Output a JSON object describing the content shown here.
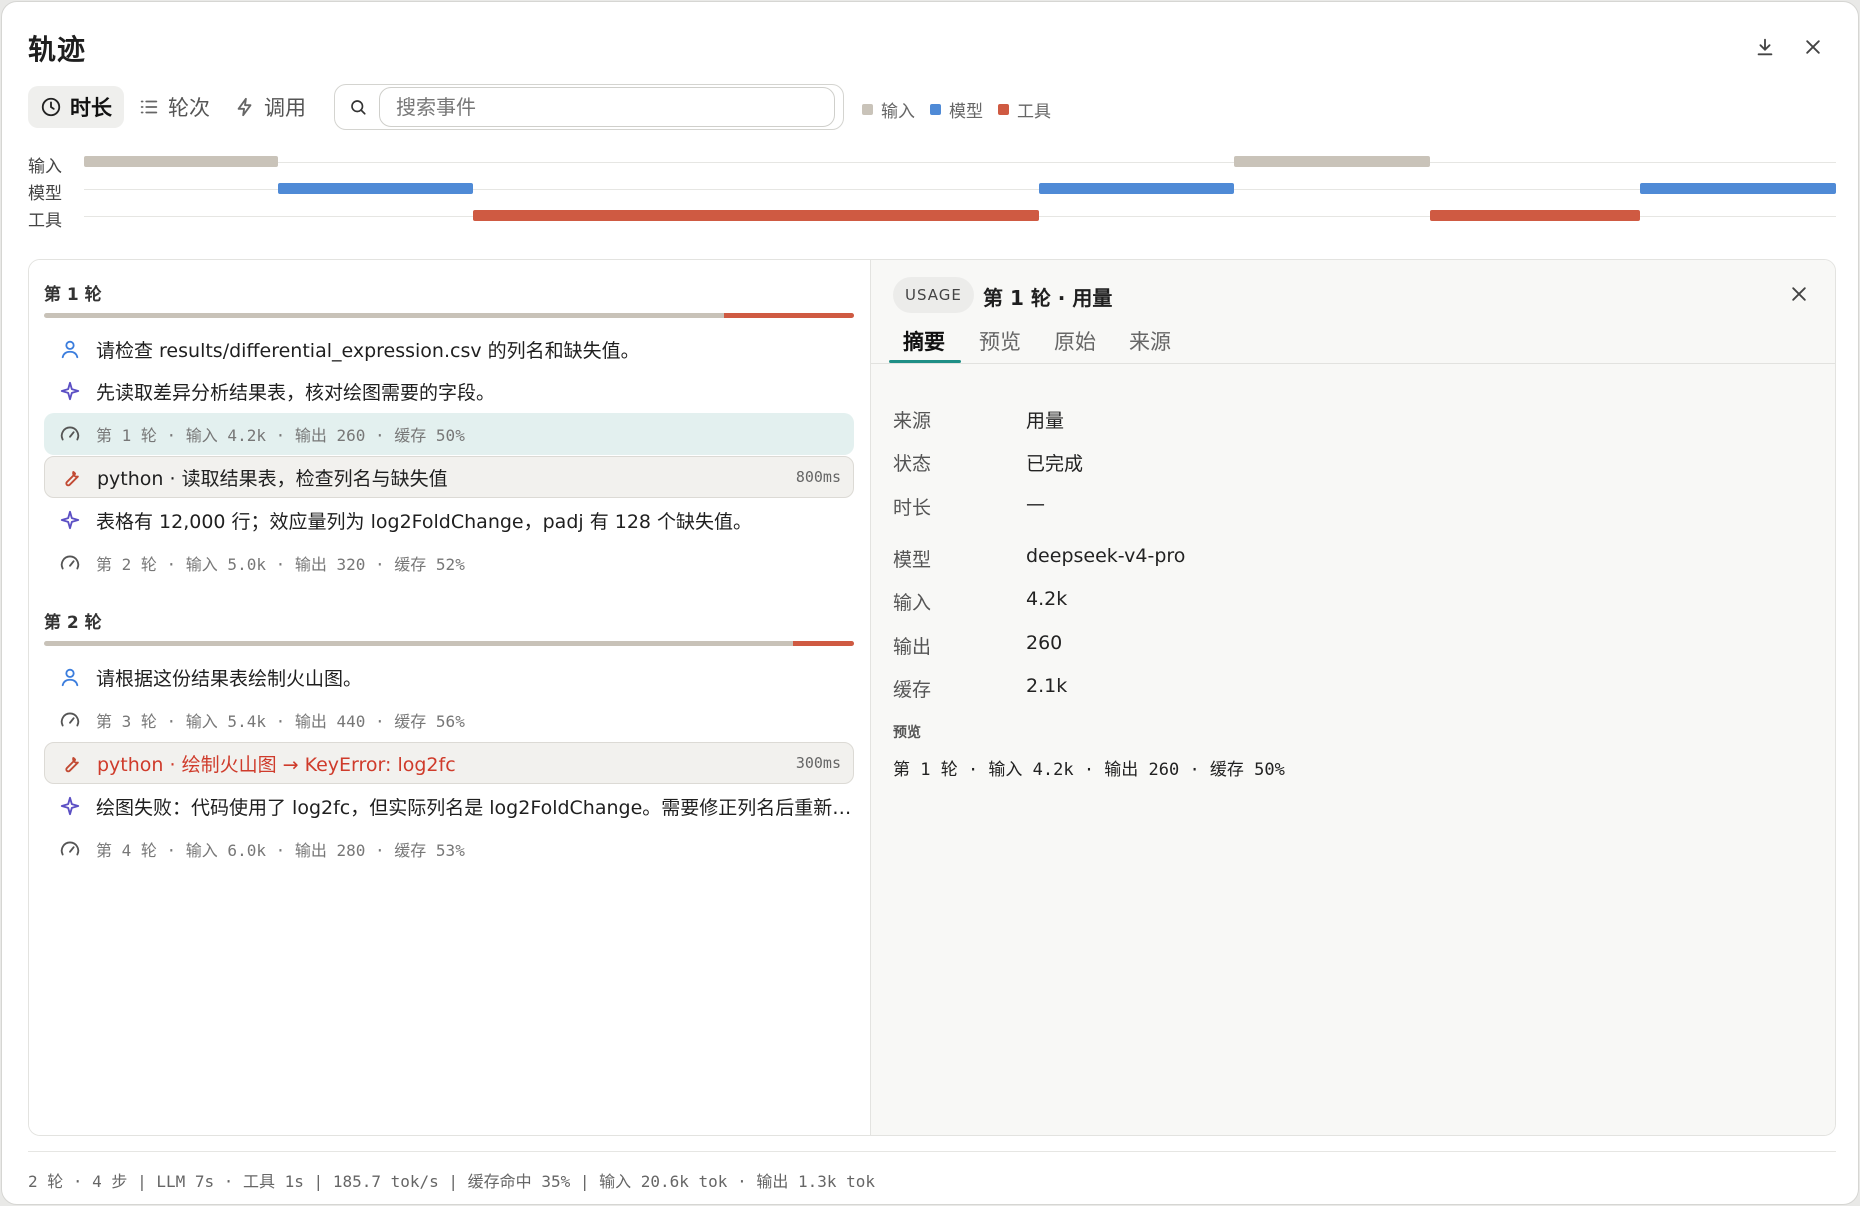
{
  "window": {
    "title": "轨迹"
  },
  "toolbar": {
    "segments": [
      {
        "label": "时长"
      },
      {
        "label": "轮次"
      },
      {
        "label": "调用"
      }
    ],
    "search_placeholder": "搜索事件",
    "legend": [
      {
        "label": "输入",
        "color": "#c9c3b9"
      },
      {
        "label": "模型",
        "color": "#4f8ad6"
      },
      {
        "label": "工具",
        "color": "#cf5a42"
      }
    ]
  },
  "timeline": {
    "lanes": [
      "输入",
      "模型",
      "工具"
    ]
  },
  "rounds": [
    {
      "title": "第 1 轮",
      "tool_share": 0.16,
      "items": [
        {
          "type": "user",
          "text": "请检查 results/differential_expression.csv 的列名和缺失值。"
        },
        {
          "type": "model",
          "text": "先读取差异分析结果表，核对绘图需要的字段。"
        },
        {
          "type": "usage",
          "text": "第 1 轮 · 输入 4.2k · 输出 260 · 缓存 50%",
          "selected": true
        },
        {
          "type": "tool",
          "text": "python · 读取结果表，检查列名与缺失值",
          "duration": "800ms"
        },
        {
          "type": "model",
          "text": "表格有 12,000 行；效应量列为 log2FoldChange，padj 有 128 个缺失值。"
        },
        {
          "type": "usage",
          "text": "第 2 轮 · 输入 5.0k · 输出 320 · 缓存 52%"
        }
      ]
    },
    {
      "title": "第 2 轮",
      "tool_share": 0.075,
      "items": [
        {
          "type": "user",
          "text": "请根据这份结果表绘制火山图。"
        },
        {
          "type": "usage",
          "text": "第 3 轮 · 输入 5.4k · 输出 440 · 缓存 56%"
        },
        {
          "type": "tool",
          "text": "python · 绘制火山图 → KeyError: log2fc",
          "duration": "300ms",
          "error": true
        },
        {
          "type": "model",
          "text": "绘图失败：代码使用了 log2fc，但实际列名是 log2FoldChange。需要修正列名后重新绘图。"
        },
        {
          "type": "usage",
          "text": "第 4 轮 · 输入 6.0k · 输出 280 · 缓存 53%"
        }
      ]
    }
  ],
  "detail": {
    "badge": "USAGE",
    "title": "第 1 轮 · 用量",
    "tabs": [
      "摘要",
      "预览",
      "原始",
      "来源"
    ],
    "fields": [
      {
        "key": "来源",
        "value": "用量"
      },
      {
        "key": "状态",
        "value": "已完成"
      },
      {
        "key": "时长",
        "value": "—"
      },
      {
        "key": "模型",
        "value": "deepseek-v4-pro"
      },
      {
        "key": "输入",
        "value": "4.2k"
      },
      {
        "key": "输出",
        "value": "260"
      },
      {
        "key": "缓存",
        "value": "2.1k"
      }
    ],
    "preview_heading": "预览",
    "preview_text": "第 1 轮 · 输入 4.2k · 输出 260 · 缓存 50%"
  },
  "footer": {
    "stats": "2 轮 · 4 步 | LLM 7s · 工具 1s | 185.7 tok/s | 缓存命中 35% | 输入 20.6k tok · 输出 1.3k tok"
  }
}
